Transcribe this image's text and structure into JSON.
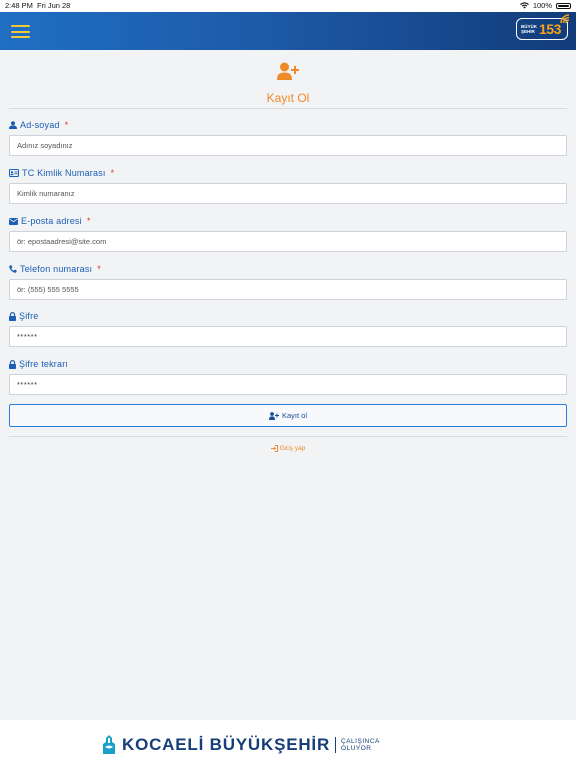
{
  "status_bar": {
    "time": "2:48 PM",
    "date": "Fri Jun 28",
    "battery": "100%"
  },
  "header": {
    "logo": {
      "small_top": "BÜYÜK",
      "small_bottom": "ŞEHİR",
      "number": "153"
    },
    "menu_icon": "hamburger-icon"
  },
  "page": {
    "title": "Kayıt Ol",
    "title_icon": "user-plus-icon"
  },
  "form": {
    "fields": [
      {
        "label": "Ad-soyad",
        "required": "*",
        "icon": "user-icon",
        "placeholder": "Adınız soyadınız"
      },
      {
        "label": "TC Kimlik Numarası",
        "required": "*",
        "icon": "id-card-icon",
        "placeholder": "Kimlik numaranız"
      },
      {
        "label": "E-posta adresi",
        "required": "*",
        "icon": "envelope-icon",
        "placeholder": "ör: epostaadresi@site.com"
      },
      {
        "label": "Telefon numarası",
        "required": "*",
        "icon": "phone-icon",
        "placeholder": "ör: (555) 555 5555"
      },
      {
        "label": "Şifre",
        "icon": "lock-icon",
        "placeholder": "******"
      },
      {
        "label": "Şifre tekrarı",
        "icon": "lock-icon",
        "placeholder": "******"
      }
    ],
    "submit_label": "Kayıt ol",
    "login_link": "Giriş yap"
  },
  "footer": {
    "brand": "KOCAELİ BÜYÜKŞEHİR",
    "slogan_line1": "ÇALIŞINCA",
    "slogan_line2": "OLUYOR"
  },
  "colors": {
    "header_start": "#1f6fc4",
    "header_end": "#123c7a",
    "accent_orange": "#ee8a2a",
    "label_blue": "#1a5fb4",
    "required_red": "#d9342b",
    "brand_navy": "#163e7a"
  }
}
